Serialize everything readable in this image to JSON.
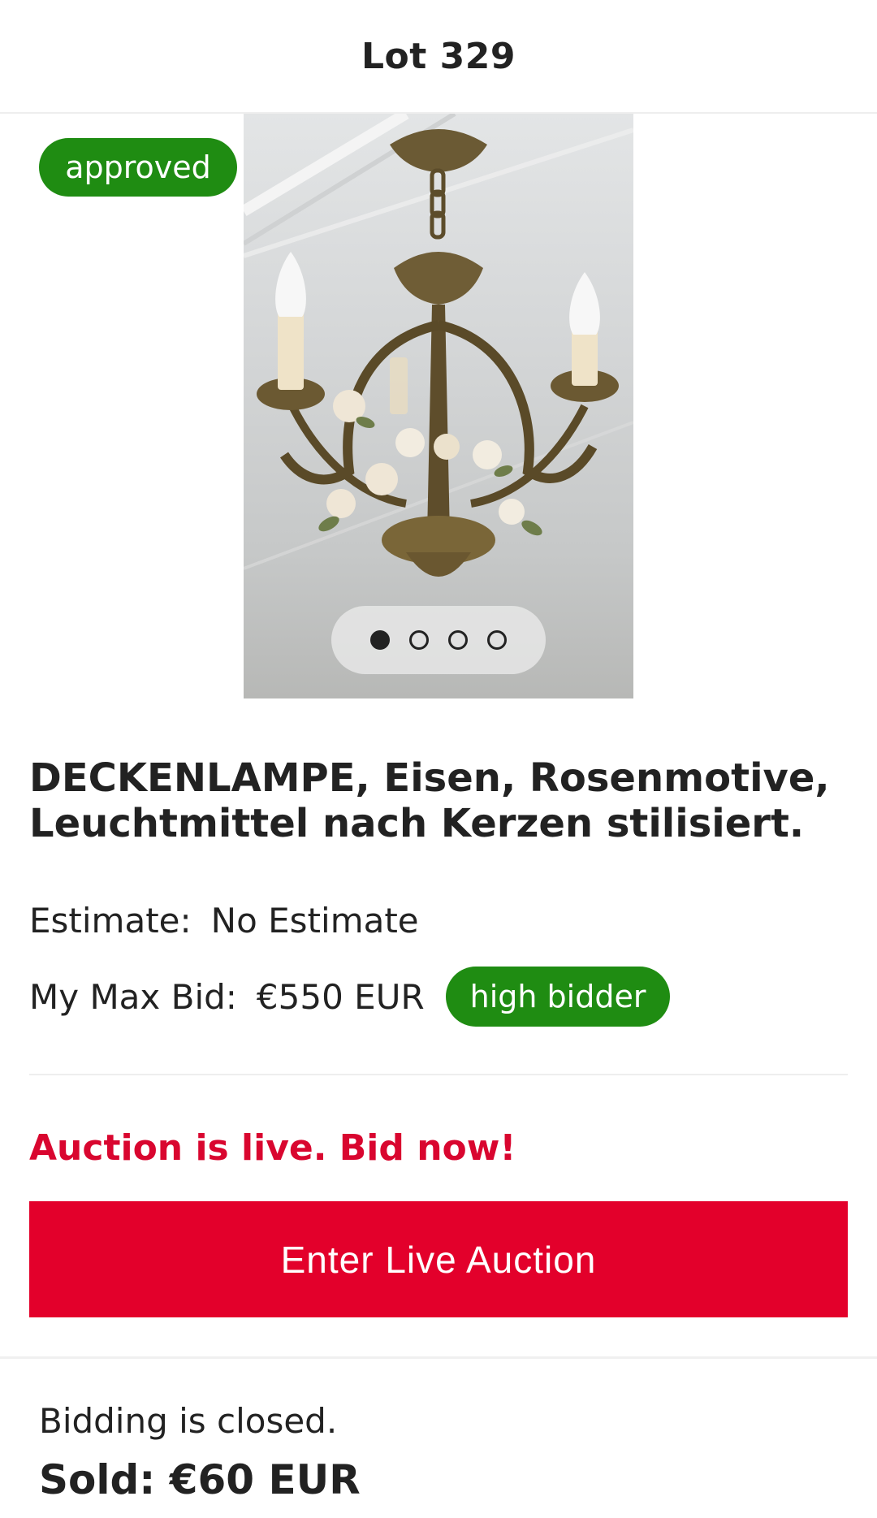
{
  "header": {
    "title": "Lot 329"
  },
  "status_badge": "approved",
  "gallery": {
    "image": "chandelier-photo",
    "slide_count": 4,
    "active_slide": 1
  },
  "lot": {
    "description": "DECKENLAMPE, Eisen, Rosenmotive, Leuchtmittel nach Kerzen stilisiert.",
    "estimate_label": "Estimate:",
    "estimate_value": "No Estimate",
    "max_bid_label": "My Max Bid:",
    "max_bid_value": "€550 EUR",
    "bid_status": "high bidder"
  },
  "auction": {
    "live_message": "Auction is live. Bid now!",
    "enter_button": "Enter Live Auction"
  },
  "footer": {
    "closed_text": "Bidding is closed.",
    "sold_text": "Sold: €60 EUR"
  },
  "colors": {
    "accent": "#e3002b",
    "badge_green": "#1f8c12",
    "live_text": "#d9062f"
  }
}
